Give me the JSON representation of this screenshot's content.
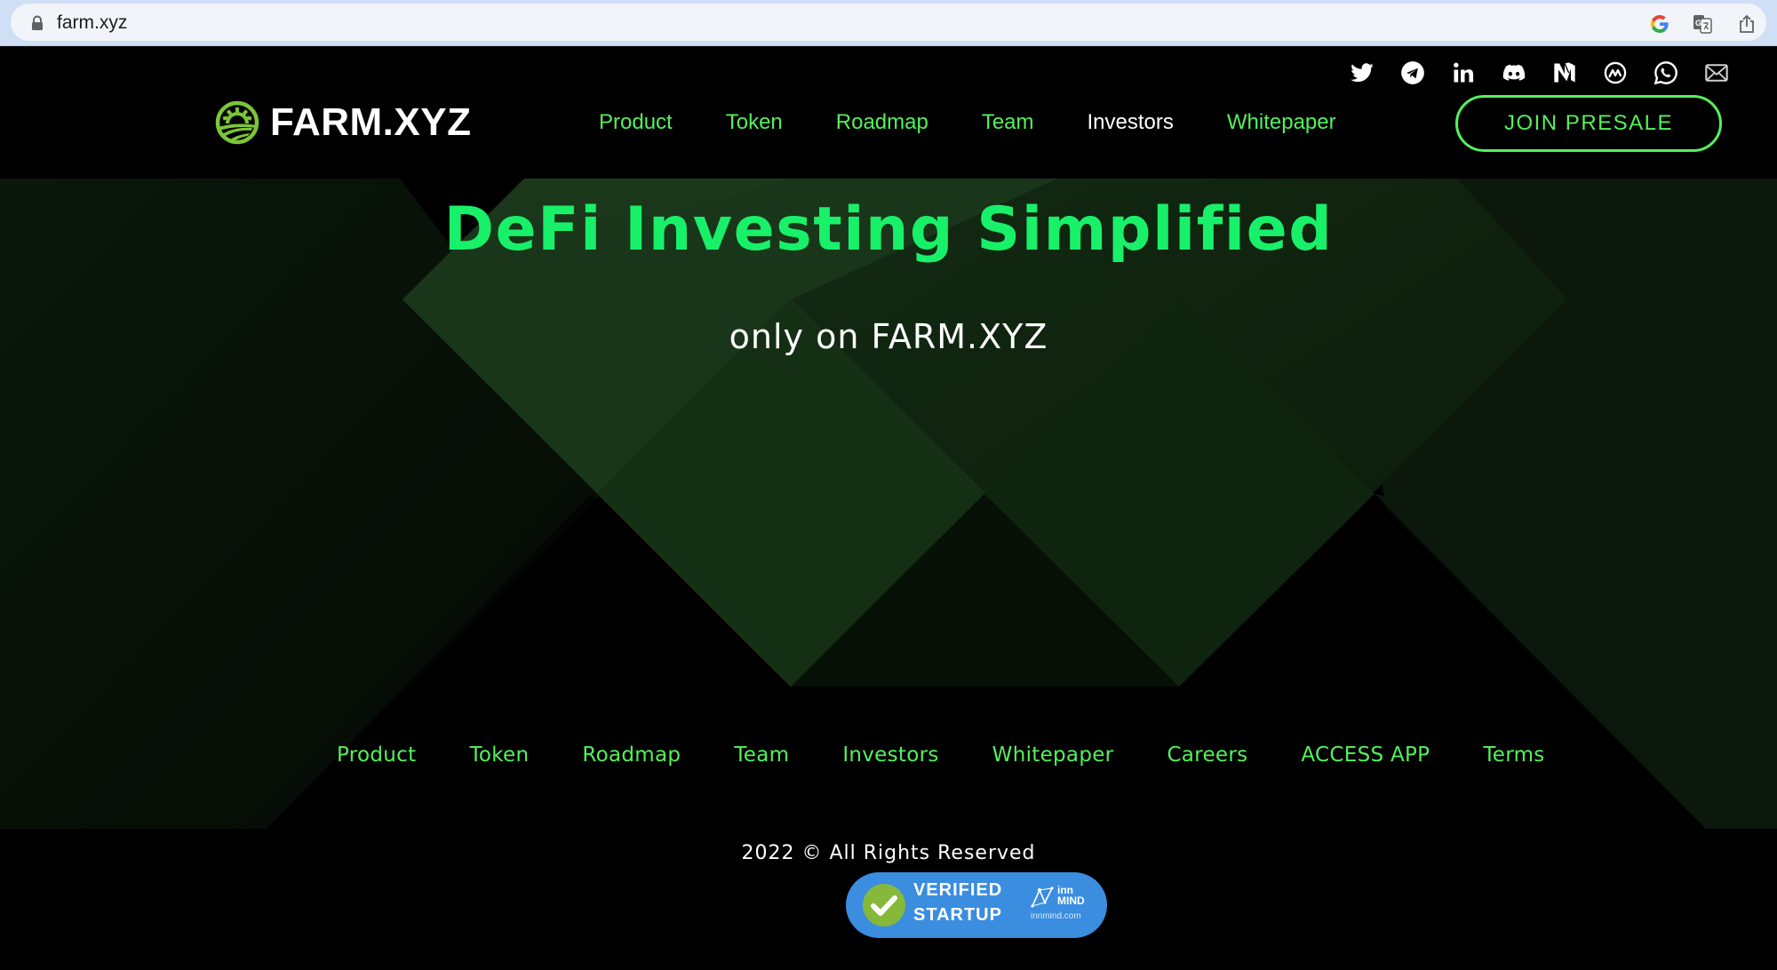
{
  "browser": {
    "url": "farm.xyz",
    "icons": [
      "lock-icon",
      "google-icon",
      "translate-icon",
      "share-icon"
    ]
  },
  "header": {
    "social_icons": [
      {
        "name": "twitter-icon"
      },
      {
        "name": "telegram-icon"
      },
      {
        "name": "linkedin-icon"
      },
      {
        "name": "discord-icon"
      },
      {
        "name": "medium-icon"
      },
      {
        "name": "coinmarketcap-icon"
      },
      {
        "name": "whatsapp-icon"
      },
      {
        "name": "email-icon"
      }
    ],
    "logo_text": "FARM.XYZ",
    "nav": [
      {
        "label": "Product",
        "active": false
      },
      {
        "label": "Token",
        "active": false
      },
      {
        "label": "Roadmap",
        "active": false
      },
      {
        "label": "Team",
        "active": false
      },
      {
        "label": "Investors",
        "active": true
      },
      {
        "label": "Whitepaper",
        "active": false
      }
    ],
    "cta_label": "JOIN PRESALE"
  },
  "hero": {
    "title": "DeFi Investing Simplified",
    "subtitle": "only on FARM.XYZ"
  },
  "footer": {
    "links": [
      "Product",
      "Token",
      "Roadmap",
      "Team",
      "Investors",
      "Whitepaper",
      "Careers",
      "ACCESS APP",
      "Terms"
    ],
    "copyright": "2022 © All Rights Reserved",
    "badge": {
      "line1": "VERIFIED",
      "line2": "STARTUP",
      "brand_1": "inn",
      "brand_2": "MIND",
      "domain": "innmind.com"
    }
  },
  "colors": {
    "accent_green": "#55f05c",
    "hero_green": "#19f06a",
    "logo_green": "#7cc53a",
    "badge_blue": "#3b8de0",
    "background": "#000000"
  }
}
